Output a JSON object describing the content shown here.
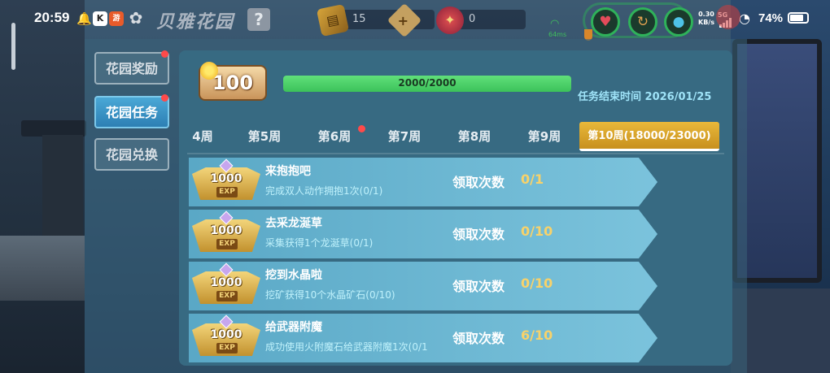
{
  "statusbar": {
    "time": "20:59",
    "bell_glyph": "🔔",
    "k_glyph": "K",
    "app_glyph": "游",
    "flower_glyph": "✿",
    "net_speed": "0.30",
    "net_unit": "KB/s",
    "signal_label": "5G",
    "battery": "74%"
  },
  "header": {
    "title": "贝雅花园",
    "help_glyph": "?",
    "book_glyph": "▤",
    "book_count": "15",
    "plus_glyph": "+",
    "gem_glyph": "✦",
    "gem_count": "0",
    "ping": "64ms",
    "heart_glyph": "♥",
    "arm_glyph": "↻",
    "drop_glyph": "●"
  },
  "sidebar": {
    "items": [
      {
        "label": "花园奖励"
      },
      {
        "label": "花园任务"
      },
      {
        "label": "花园兑换"
      }
    ]
  },
  "level": {
    "value": "100",
    "progress_text": "2000/2000",
    "progress_fraction": 1.0
  },
  "end_time": "任务结束时间 2026/01/25",
  "weeks": [
    {
      "label": "4周"
    },
    {
      "label": "第5周"
    },
    {
      "label": "第6周"
    },
    {
      "label": "第7周"
    },
    {
      "label": "第8周"
    },
    {
      "label": "第9周"
    },
    {
      "label": "第10周(18000/23000)"
    }
  ],
  "tasks": [
    {
      "exp": "1000",
      "exp_tag": "EXP",
      "title": "来抱抱吧",
      "desc": "完成双人动作拥抱1次(0/1)",
      "count_label": "领取次数",
      "count": "0/1"
    },
    {
      "exp": "1000",
      "exp_tag": "EXP",
      "title": "去采龙涎草",
      "desc": "采集获得1个龙涎草(0/1)",
      "count_label": "领取次数",
      "count": "0/10"
    },
    {
      "exp": "1000",
      "exp_tag": "EXP",
      "title": "挖到水晶啦",
      "desc": "挖矿获得10个水晶矿石(0/10)",
      "count_label": "领取次数",
      "count": "0/10"
    },
    {
      "exp": "1000",
      "exp_tag": "EXP",
      "title": "给武器附魔",
      "desc": "成功使用火附魔石给武器附魔1次(0/1",
      "count_label": "领取次数",
      "count": "6/10"
    }
  ],
  "colors": {
    "accent_active_tab": "#2d7fb4",
    "week_active": "#e9b83a",
    "progress": "#3cc25a",
    "count_value": "#f8d26a",
    "badge_red": "#ff4a4a"
  }
}
